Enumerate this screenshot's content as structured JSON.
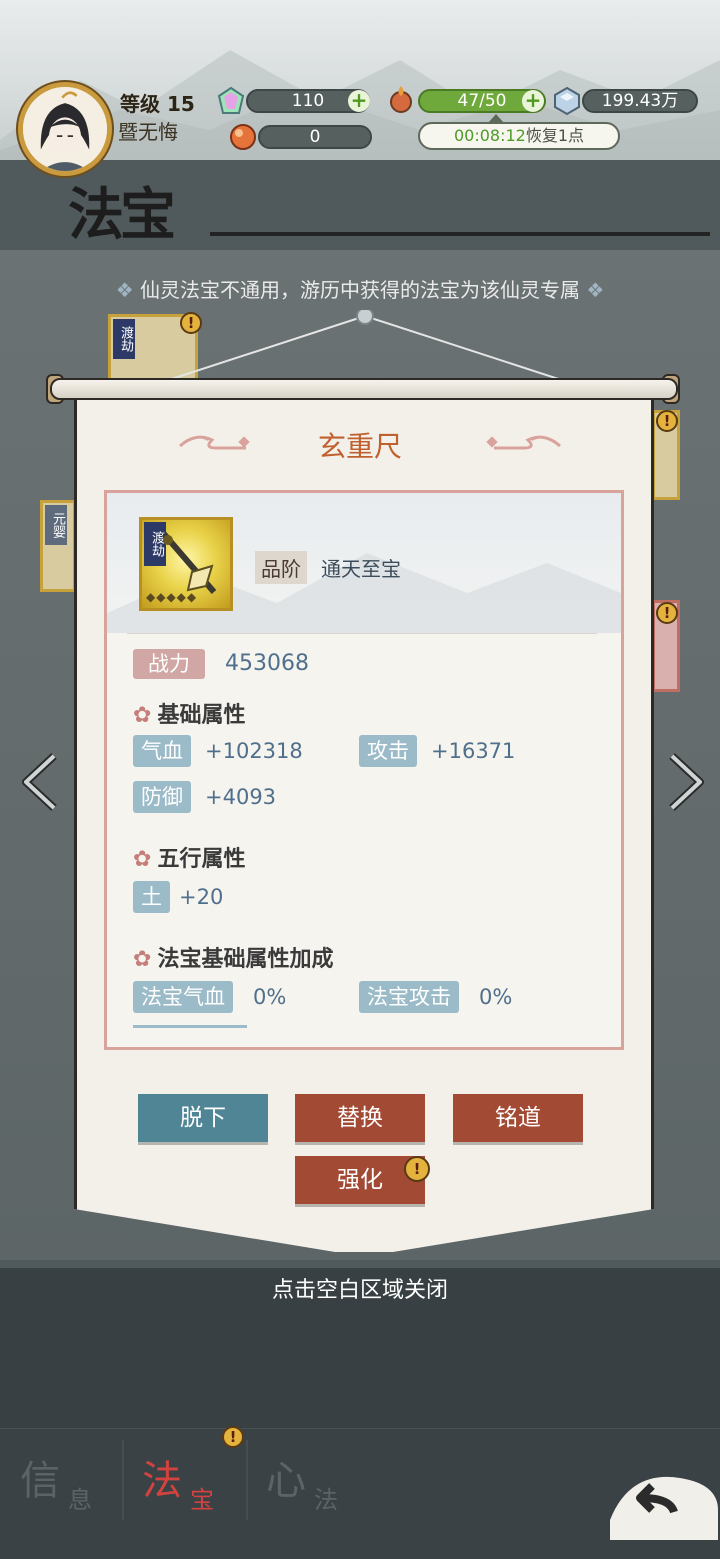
{
  "player": {
    "level_label": "等级",
    "level_value": "15",
    "name": "暨无悔"
  },
  "resources": {
    "gem": "110",
    "stamina": "47/50",
    "crystal": "199.43万",
    "orb": "0",
    "recover": "恢复1点",
    "timer": "00:08:12"
  },
  "section": {
    "title": "法宝",
    "hint": "仙灵法宝不通用，游历中获得的法宝为该仙灵专属"
  },
  "item": {
    "name": "玄重尺",
    "tag": "渡劫",
    "grade_label": "品阶",
    "grade_value": "通天至宝",
    "power_label": "战力",
    "power_value": "453068",
    "base_head": "基础属性",
    "base_stats": [
      {
        "label": "气血",
        "value": "+102318"
      },
      {
        "label": "攻击",
        "value": "+16371"
      },
      {
        "label": "防御",
        "value": "+4093"
      }
    ],
    "element_head": "五行属性",
    "element_stats": [
      {
        "label": "土",
        "value": "+20"
      }
    ],
    "bonus_head": "法宝基础属性加成",
    "bonus_stats": [
      {
        "label": "法宝气血",
        "value": "0%"
      },
      {
        "label": "法宝攻击",
        "value": "0%"
      }
    ]
  },
  "buttons": {
    "unequip": "脱下",
    "replace": "替换",
    "inscribe": "铭道",
    "enhance": "强化"
  },
  "close_hint": "点击空白区域关闭",
  "side_tags": {
    "left_top": "渡劫",
    "left_mid": "元婴"
  },
  "tabs": [
    {
      "big": "信",
      "small": "息"
    },
    {
      "big": "法",
      "small": "宝"
    },
    {
      "big": "心",
      "small": "法"
    }
  ],
  "badge": "!",
  "colors": {
    "accent_red": "#a34a35",
    "accent_blue": "#4f8595",
    "title_orange": "#c0602e",
    "stat_blue": "#4f6f8c"
  }
}
